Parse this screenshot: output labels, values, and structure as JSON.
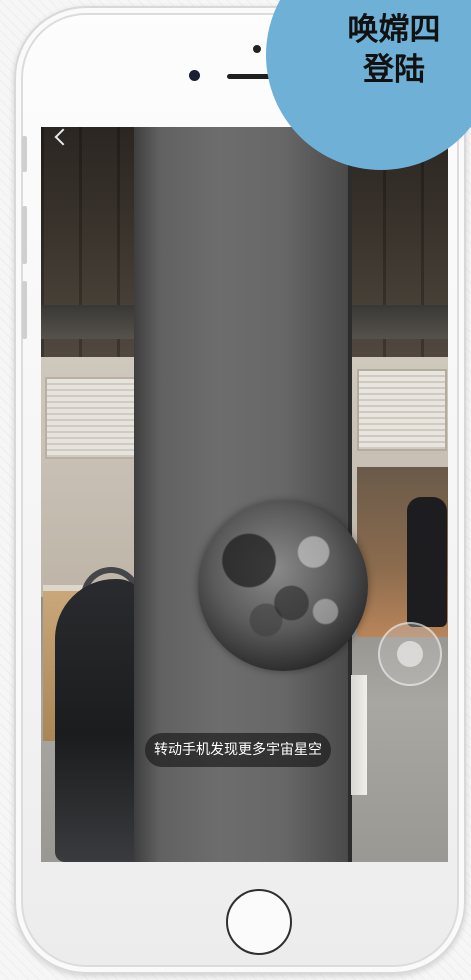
{
  "overlay_badge": {
    "line1": "唤嫦四",
    "line2": "登陆",
    "color": "#6fb0d6"
  },
  "phone": {
    "front_camera_icon": "camera-dot-icon",
    "speaker_icon": "earpiece-speaker-icon",
    "home_button_icon": "home-button-icon"
  },
  "ar_view": {
    "back_icon": "chevron-left-icon",
    "object_icon": "moon-icon",
    "control_icon": "ar-joystick-icon",
    "hint_text": "转动手机发现更多宇宙星空"
  }
}
